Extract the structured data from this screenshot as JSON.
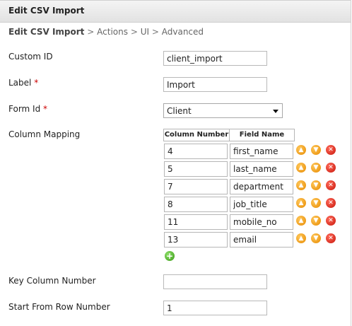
{
  "window": {
    "title": "Edit CSV Import"
  },
  "breadcrumb": {
    "current": "Edit CSV Import",
    "sep": ">",
    "items": [
      "Actions",
      "UI",
      "Advanced"
    ]
  },
  "form": {
    "custom_id": {
      "label": "Custom ID",
      "value": "client_import"
    },
    "label": {
      "label": "Label",
      "required": "*",
      "value": "Import"
    },
    "form_id": {
      "label": "Form Id",
      "required": "*",
      "selected": "Client"
    },
    "column_mapping": {
      "label": "Column Mapping",
      "headers": [
        "Column Number",
        "Field Name"
      ],
      "rows": [
        {
          "col": "4",
          "field": "first_name"
        },
        {
          "col": "5",
          "field": "last_name"
        },
        {
          "col": "7",
          "field": "department"
        },
        {
          "col": "8",
          "field": "job_title"
        },
        {
          "col": "11",
          "field": "mobile_no"
        },
        {
          "col": "13",
          "field": "email"
        }
      ]
    },
    "key_column": {
      "label": "Key Column Number",
      "value": ""
    },
    "start_row": {
      "label": "Start From Row Number",
      "value": "1"
    }
  },
  "icons": {
    "move_up": "arrow-up-icon",
    "move_down": "arrow-down-icon",
    "delete": "delete-icon",
    "add": "add-icon"
  },
  "colors": {
    "required": "#cc0000",
    "move": "#e78a00",
    "delete": "#c8160a",
    "add": "#3a9a16"
  }
}
